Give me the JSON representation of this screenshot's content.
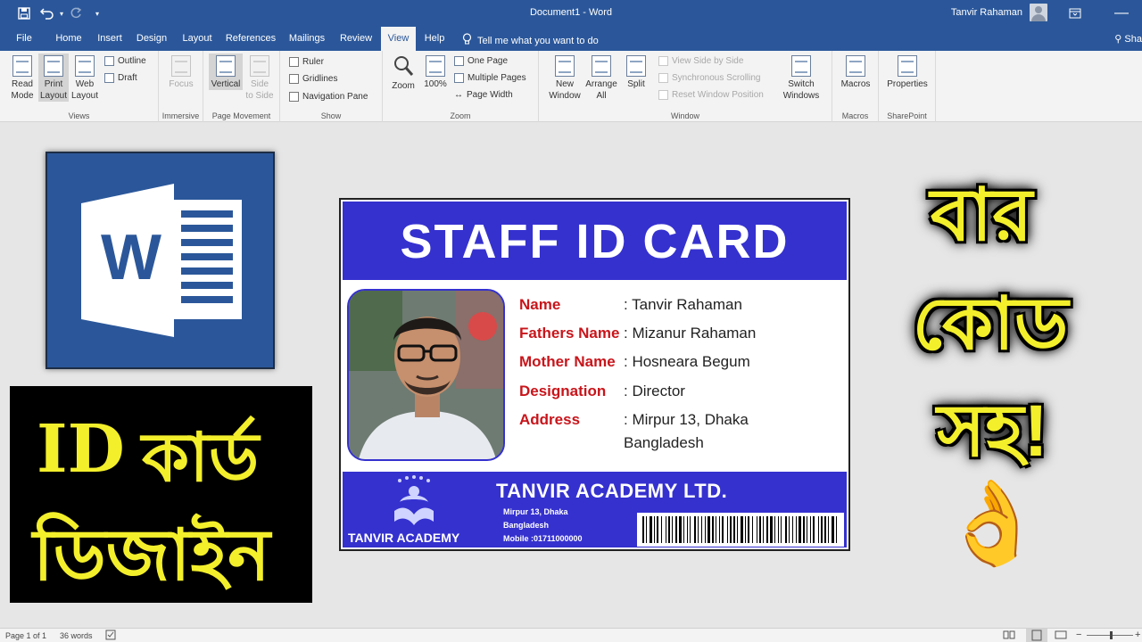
{
  "titlebar": {
    "doc_title": "Document1  -  Word",
    "user_name": "Tanvir Rahaman"
  },
  "tabs": [
    "File",
    "Home",
    "Insert",
    "Design",
    "Layout",
    "References",
    "Mailings",
    "Review",
    "View",
    "Help"
  ],
  "active_tab": "View",
  "tell_me": "Tell me what you want to do",
  "share": "Sha",
  "ribbon": {
    "views": {
      "label": "Views",
      "read_mode": [
        "Read",
        "Mode"
      ],
      "print_layout": [
        "Print",
        "Layout"
      ],
      "web_layout": [
        "Web",
        "Layout"
      ],
      "outline": "Outline",
      "draft": "Draft"
    },
    "immersive": {
      "label": "Immersive",
      "focus": "Focus"
    },
    "page_movement": {
      "label": "Page Movement",
      "vertical": "Vertical",
      "side": [
        "Side",
        "to Side"
      ]
    },
    "show": {
      "label": "Show",
      "ruler": "Ruler",
      "gridlines": "Gridlines",
      "nav_pane": "Navigation Pane"
    },
    "zoom": {
      "label": "Zoom",
      "zoom": "Zoom",
      "pct": "100%",
      "one_page": "One Page",
      "multiple_pages": "Multiple Pages",
      "page_width": "Page Width"
    },
    "window": {
      "label": "Window",
      "new_window": [
        "New",
        "Window"
      ],
      "arrange_all": [
        "Arrange",
        "All"
      ],
      "split": "Split",
      "view_side": "View Side by Side",
      "sync_scroll": "Synchronous Scrolling",
      "reset_pos": "Reset Window Position",
      "switch_windows": [
        "Switch",
        "Windows"
      ]
    },
    "macros": {
      "label": "Macros",
      "macros": "Macros"
    },
    "sharepoint": {
      "label": "SharePoint",
      "properties": "Properties"
    }
  },
  "thumbnail": {
    "word_logo_letter": "W",
    "left_bangla_line1_latin": "ID",
    "left_bangla_line1": "কার্ড",
    "left_bangla_line2": "ডিজাইন",
    "right_bangla_1": "বার",
    "right_bangla_2": "কোড",
    "right_bangla_3": "সহ!",
    "emoji": "👌"
  },
  "card": {
    "title": "STAFF ID CARD",
    "fields": [
      {
        "label": "Name",
        "value": ": Tanvir Rahaman"
      },
      {
        "label": "Fathers Name",
        "value": ": Mizanur Rahaman"
      },
      {
        "label": "Mother Name",
        "value": ": Hosneara Begum"
      },
      {
        "label": "Designation",
        "value": ": Director"
      },
      {
        "label": "Address",
        "value": ": Mirpur 13, Dhaka",
        "value2": "Bangladesh"
      }
    ],
    "company": "TANVIR ACADEMY LTD.",
    "addr1": "Mirpur 13, Dhaka",
    "addr2": "Bangladesh",
    "mobile": "Mobile :01711000000",
    "logo_text": "TANVIR ACADEMY",
    "colors": {
      "primary": "#3531cf",
      "label": "#c8151b"
    }
  },
  "status": {
    "page": "Page 1 of 1",
    "words": "36 words"
  }
}
